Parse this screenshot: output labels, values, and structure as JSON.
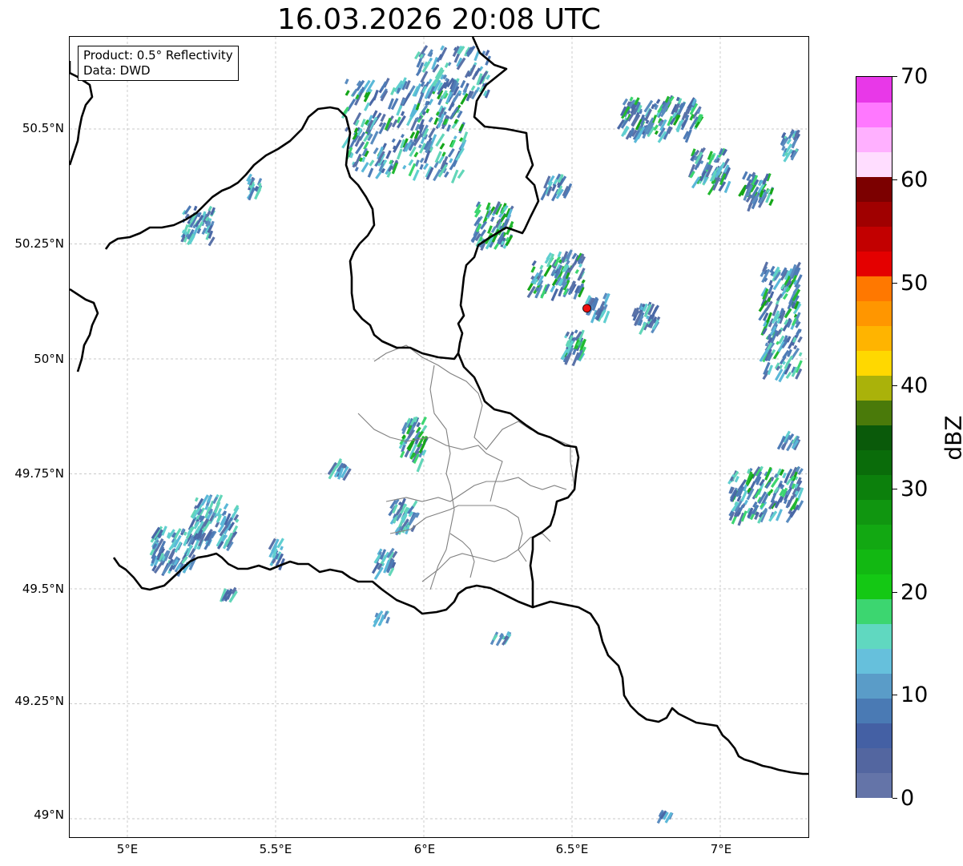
{
  "title": "16.03.2026 20:08 UTC",
  "info": {
    "product": "Product: 0.5° Reflectivity",
    "data": "Data: DWD"
  },
  "lat_labels": [
    "50.5°N",
    "50.25°N",
    "50°N",
    "49.75°N",
    "49.5°N",
    "49.25°N",
    "49°N"
  ],
  "lon_labels": [
    "5°E",
    "5.5°E",
    "6°E",
    "6.5°E",
    "7°E"
  ],
  "colorbar": {
    "label": "dBZ",
    "ticks": [
      "0",
      "10",
      "20",
      "30",
      "40",
      "50",
      "60",
      "70"
    ],
    "colors": [
      "#6474a8",
      "#5366a0",
      "#4460a4",
      "#4a7ab4",
      "#5a9cc8",
      "#66c0dc",
      "#60d8c0",
      "#3cd670",
      "#14c814",
      "#12b812",
      "#12a812",
      "#109610",
      "#0c800c",
      "#0a6c0a",
      "#0a5a0a",
      "#4a7a0a",
      "#aab20a",
      "#ffd800",
      "#ffb400",
      "#ff9600",
      "#ff7800",
      "#e40000",
      "#c20000",
      "#a00000",
      "#7c0000",
      "#ffddff",
      "#ffb0ff",
      "#ff78ff",
      "#e838e8"
    ]
  },
  "radar_marker": {
    "lat": 50.11,
    "lon": 6.55,
    "color": "#ee1111"
  },
  "colors": {
    "border": "#000000",
    "district": "#808080",
    "grid": "#b8b8b8"
  }
}
